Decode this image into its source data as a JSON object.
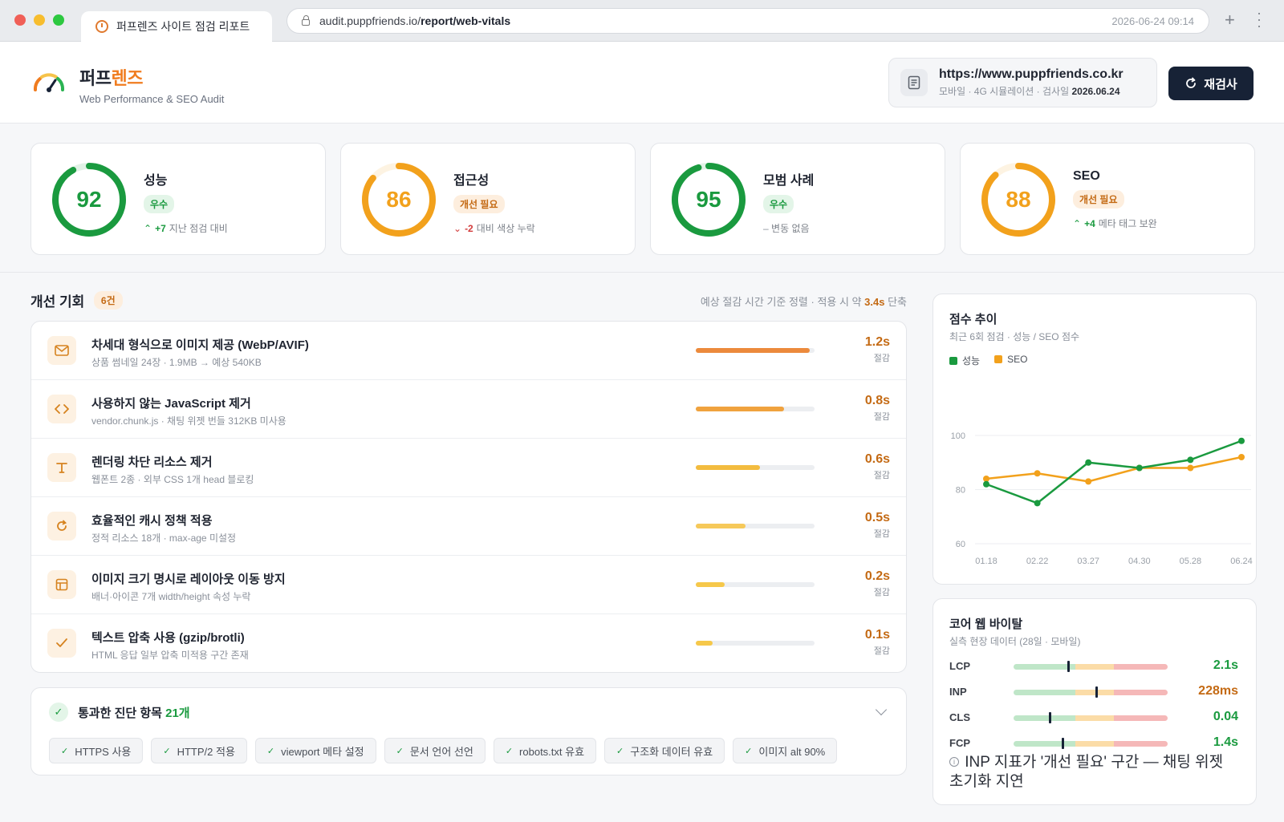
{
  "browser": {
    "tab_title": "퍼프렌즈 사이트 점검 리포트",
    "address_host": "audit.puppfriends.io/",
    "address_path": "report/web-vitals",
    "timestamp": "2026-06-24 09:14"
  },
  "header": {
    "brand_part1": "퍼프",
    "brand_part2": "렌즈",
    "brand_sub": "Web Performance & SEO Audit",
    "site_url": "https://www.puppfriends.co.kr",
    "site_meta_prefix": "모바일 · 4G 시뮬레이션 · 검사일",
    "site_meta_date": "2026.06.24",
    "recheck_label": "재검사"
  },
  "scores": [
    {
      "title": "성능",
      "score": 92,
      "badge": "우수",
      "badge_type": "good",
      "trend": "up",
      "delta": "+7",
      "delta_text": "지난 점검 대비",
      "color": "#1a9a3f"
    },
    {
      "title": "접근성",
      "score": 86,
      "badge": "개선 필요",
      "badge_type": "warn",
      "trend": "down",
      "delta": "-2",
      "delta_text": "대비 색상 누락",
      "color": "#f2a11c"
    },
    {
      "title": "모범 사례",
      "score": 95,
      "badge": "우수",
      "badge_type": "good",
      "trend": "flat",
      "delta": "",
      "delta_text": "변동 없음",
      "color": "#1a9a3f"
    },
    {
      "title": "SEO",
      "score": 88,
      "badge": "개선 필요",
      "badge_type": "warn",
      "trend": "up",
      "delta": "+4",
      "delta_text": "메타 태그 보완",
      "color": "#f2a11c"
    }
  ],
  "opportunities": {
    "title": "개선 기회",
    "count": "6건",
    "note_prefix": "예상 절감 시간 기준 정렬 · 적용 시 약",
    "note_value": "3.4s",
    "note_suffix": "단축",
    "save_label": "절감",
    "items": [
      {
        "icon": "mail-icon",
        "name": "차세대 형식으로 이미지 제공 (WebP/AVIF)",
        "desc": "상품 썸네일 24장 · 1.9MB → 예상 540KB",
        "saving": "1.2s",
        "ratio": 0.96,
        "color": "#ec8a3c"
      },
      {
        "icon": "code-icon",
        "name": "사용하지 않는 JavaScript 제거",
        "desc": "vendor.chunk.js · 채팅 위젯 번들 312KB 미사용",
        "saving": "0.8s",
        "ratio": 0.74,
        "color": "#f0a23e"
      },
      {
        "icon": "text-icon",
        "name": "렌더링 차단 리소스 제거",
        "desc": "웹폰트 2종 · 외부 CSS 1개 head 블로킹",
        "saving": "0.6s",
        "ratio": 0.54,
        "color": "#f3bc3f"
      },
      {
        "icon": "refresh-icon",
        "name": "효율적인 캐시 정책 적용",
        "desc": "정적 리소스 18개 · max-age 미설정",
        "saving": "0.5s",
        "ratio": 0.42,
        "color": "#f6c95a"
      },
      {
        "icon": "layout-icon",
        "name": "이미지 크기 명시로 레이아웃 이동 방지",
        "desc": "배너·아이콘 7개 width/height 속성 누락",
        "saving": "0.2s",
        "ratio": 0.24,
        "color": "#f6c84a"
      },
      {
        "icon": "check-icon",
        "name": "텍스트 압축 사용 (gzip/brotli)",
        "desc": "HTML 응답 일부 압축 미적용 구간 존재",
        "saving": "0.1s",
        "ratio": 0.14,
        "color": "#f6c84a"
      }
    ]
  },
  "passed": {
    "title": "통과한 진단 항목",
    "count": "21개",
    "chips": [
      "HTTPS 사용",
      "HTTP/2 적용",
      "viewport 메타 설정",
      "문서 언어 선언",
      "robots.txt 유효",
      "구조화 데이터 유효",
      "이미지 alt 90%"
    ]
  },
  "trend_panel": {
    "title": "점수 추이",
    "subtitle": "최근 6회 점검 · 성능 / SEO 점수"
  },
  "chart_data": {
    "type": "line",
    "x": [
      "01.18",
      "02.22",
      "03.27",
      "04.30",
      "05.28",
      "06.24"
    ],
    "series": [
      {
        "name": "성능",
        "color": "#1a9a3f",
        "values": [
          82,
          75,
          90,
          88,
          91,
          98
        ]
      },
      {
        "name": "SEO",
        "color": "#f2a11c",
        "values": [
          84,
          86,
          83,
          88,
          88,
          92
        ]
      }
    ],
    "ylim": [
      60,
      100
    ],
    "yticks": [
      60,
      80,
      100
    ],
    "grid": true,
    "legend": "top-left"
  },
  "cwv_panel": {
    "title": "코어 웹 바이탈",
    "subtitle": "실측 현장 데이터 (28일 · 모바일)",
    "metrics": [
      {
        "label": "LCP",
        "value": "2.1s",
        "position": 0.35,
        "color": "#1a9a3f"
      },
      {
        "label": "INP",
        "value": "228ms",
        "position": 0.53,
        "color": "#c46a14"
      },
      {
        "label": "CLS",
        "value": "0.04",
        "position": 0.23,
        "color": "#1a9a3f"
      },
      {
        "label": "FCP",
        "value": "1.4s",
        "position": 0.31,
        "color": "#1a9a3f"
      }
    ],
    "note": "INP 지표가 '개선 필요' 구간 — 채팅 위젯 초기화 지연"
  }
}
